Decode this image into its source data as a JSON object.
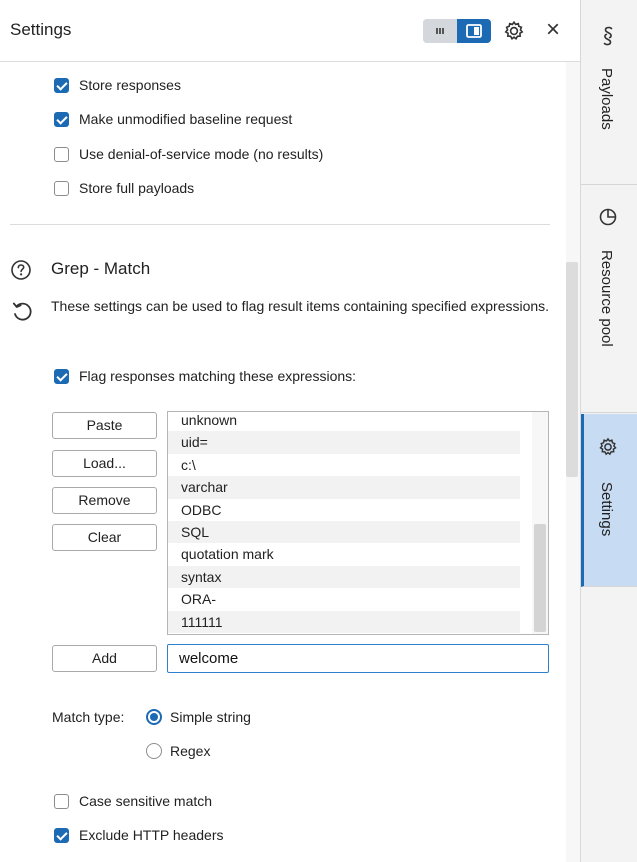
{
  "header": {
    "title": "Settings",
    "close_glyph": "×"
  },
  "response_options": [
    {
      "label": "Store responses",
      "checked": true
    },
    {
      "label": "Make unmodified baseline request",
      "checked": true
    },
    {
      "label": "Use denial-of-service mode (no results)",
      "checked": false
    },
    {
      "label": "Store full payloads",
      "checked": false
    }
  ],
  "grep_match": {
    "title": "Grep - Match",
    "description": "These settings can be used to flag result items containing specified expressions.",
    "flag_checkbox": {
      "label": "Flag responses matching these expressions:",
      "checked": true
    },
    "buttons": {
      "paste": "Paste",
      "load": "Load...",
      "remove": "Remove",
      "clear": "Clear",
      "add": "Add"
    },
    "expressions": [
      "unknown",
      "uid=",
      "c:\\",
      "varchar",
      "ODBC",
      "SQL",
      "quotation mark",
      "syntax",
      "ORA-",
      "111111"
    ],
    "add_input_value": "welcome",
    "match_type_label": "Match type:",
    "match_types": [
      {
        "label": "Simple string",
        "selected": true
      },
      {
        "label": "Regex",
        "selected": false
      }
    ],
    "case_sensitive": {
      "label": "Case sensitive match",
      "checked": false
    },
    "exclude_http_headers": {
      "label": "Exclude HTTP headers",
      "checked": true
    }
  },
  "right_rail": {
    "tabs": [
      {
        "label": "Payloads",
        "icon": "payloads-icon",
        "active": false
      },
      {
        "label": "Resource pool",
        "icon": "resource-pool-icon",
        "active": false
      },
      {
        "label": "Settings",
        "icon": "gear-icon",
        "active": true
      }
    ]
  },
  "colors": {
    "accent": "#1c6ab4",
    "active_tab_bg": "#c7dbf2"
  }
}
